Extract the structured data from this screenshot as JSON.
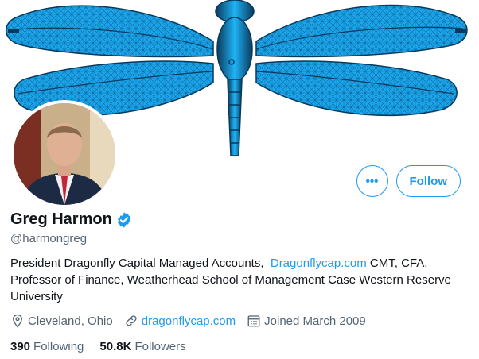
{
  "profile": {
    "display_name": "Greg Harmon",
    "handle": "@harmongreg",
    "bio_text": "President Dragonfly Capital Managed Accounts,",
    "bio_link": "Dragonflycap.com",
    "bio_rest_1": "CMT, CFA,",
    "bio_rest_2": "Professor of Finance, Weatherhead School of Management Case Western Reserve University",
    "location": "Cleveland, Ohio",
    "website": "dragonflycap.com",
    "joined": "Joined March 2009",
    "following_count": "390",
    "following_label": "Following",
    "followers_count": "50.8K",
    "followers_label": "Followers"
  },
  "actions": {
    "more_label": "•••",
    "follow_label": "Follow"
  },
  "icons": {
    "verified": "verified-badge-icon",
    "location": "location-pin-icon",
    "link": "link-icon",
    "calendar": "calendar-icon",
    "more": "more-icon"
  },
  "colors": {
    "accent": "#1d9bf0",
    "text": "#0f1419",
    "secondary": "#536471",
    "wing": "#1aa3ea"
  }
}
